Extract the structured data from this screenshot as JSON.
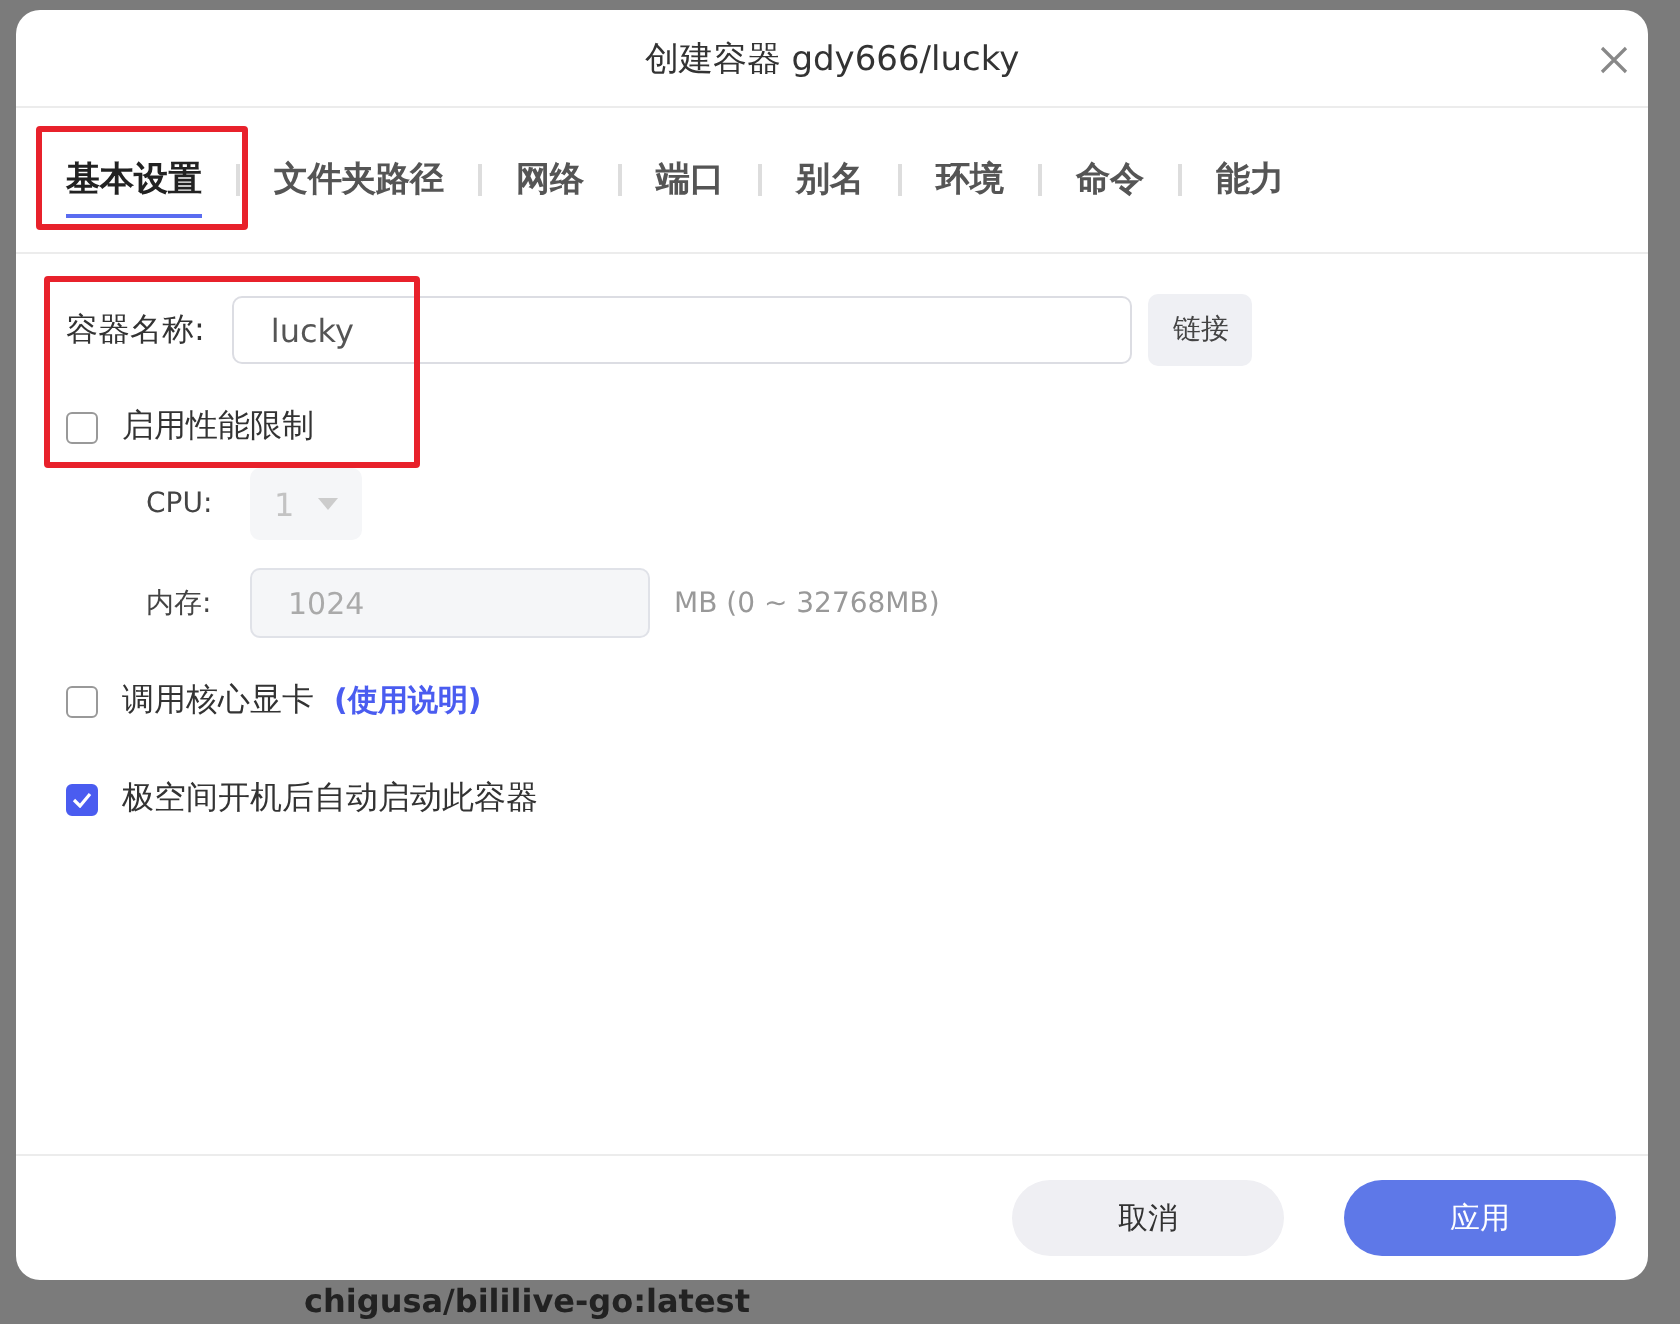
{
  "background": {
    "text": "chigusa/bililive-go:latest"
  },
  "dialog": {
    "title": "创建容器 gdy666/lucky",
    "tabs": [
      {
        "label": "基本设置",
        "selected": true
      },
      {
        "label": "文件夹路径",
        "selected": false
      },
      {
        "label": "网络",
        "selected": false
      },
      {
        "label": "端口",
        "selected": false
      },
      {
        "label": "别名",
        "selected": false
      },
      {
        "label": "环境",
        "selected": false
      },
      {
        "label": "命令",
        "selected": false
      },
      {
        "label": "能力",
        "selected": false
      }
    ],
    "name_field": {
      "label": "容器名称:",
      "value": "lucky",
      "button": "链接"
    },
    "perf_limit": {
      "label": "启用性能限制",
      "checked": false
    },
    "cpu": {
      "label": "CPU:",
      "value": "1",
      "disabled": true
    },
    "memory": {
      "label": "内存:",
      "value": "1024",
      "unit": "MB (0 ~ 32768MB)",
      "disabled": true
    },
    "gpu": {
      "label": "调用核心显卡",
      "link": "(使用说明)",
      "checked": false
    },
    "autostart": {
      "label": "极空间开机后自动启动此容器",
      "checked": true
    },
    "buttons": [
      {
        "label": "取消",
        "kind": "secondary"
      },
      {
        "label": "应用",
        "kind": "primary"
      }
    ]
  }
}
